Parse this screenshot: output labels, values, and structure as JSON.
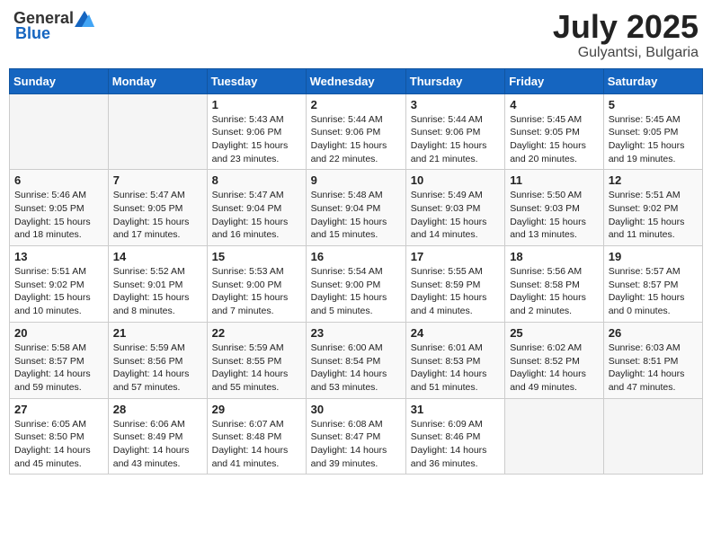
{
  "header": {
    "logo_general": "General",
    "logo_blue": "Blue",
    "month": "July 2025",
    "location": "Gulyantsi, Bulgaria"
  },
  "weekdays": [
    "Sunday",
    "Monday",
    "Tuesday",
    "Wednesday",
    "Thursday",
    "Friday",
    "Saturday"
  ],
  "weeks": [
    [
      {
        "day": "",
        "empty": true
      },
      {
        "day": "",
        "empty": true
      },
      {
        "day": "1",
        "sunrise": "Sunrise: 5:43 AM",
        "sunset": "Sunset: 9:06 PM",
        "daylight": "Daylight: 15 hours and 23 minutes."
      },
      {
        "day": "2",
        "sunrise": "Sunrise: 5:44 AM",
        "sunset": "Sunset: 9:06 PM",
        "daylight": "Daylight: 15 hours and 22 minutes."
      },
      {
        "day": "3",
        "sunrise": "Sunrise: 5:44 AM",
        "sunset": "Sunset: 9:06 PM",
        "daylight": "Daylight: 15 hours and 21 minutes."
      },
      {
        "day": "4",
        "sunrise": "Sunrise: 5:45 AM",
        "sunset": "Sunset: 9:05 PM",
        "daylight": "Daylight: 15 hours and 20 minutes."
      },
      {
        "day": "5",
        "sunrise": "Sunrise: 5:45 AM",
        "sunset": "Sunset: 9:05 PM",
        "daylight": "Daylight: 15 hours and 19 minutes."
      }
    ],
    [
      {
        "day": "6",
        "sunrise": "Sunrise: 5:46 AM",
        "sunset": "Sunset: 9:05 PM",
        "daylight": "Daylight: 15 hours and 18 minutes."
      },
      {
        "day": "7",
        "sunrise": "Sunrise: 5:47 AM",
        "sunset": "Sunset: 9:05 PM",
        "daylight": "Daylight: 15 hours and 17 minutes."
      },
      {
        "day": "8",
        "sunrise": "Sunrise: 5:47 AM",
        "sunset": "Sunset: 9:04 PM",
        "daylight": "Daylight: 15 hours and 16 minutes."
      },
      {
        "day": "9",
        "sunrise": "Sunrise: 5:48 AM",
        "sunset": "Sunset: 9:04 PM",
        "daylight": "Daylight: 15 hours and 15 minutes."
      },
      {
        "day": "10",
        "sunrise": "Sunrise: 5:49 AM",
        "sunset": "Sunset: 9:03 PM",
        "daylight": "Daylight: 15 hours and 14 minutes."
      },
      {
        "day": "11",
        "sunrise": "Sunrise: 5:50 AM",
        "sunset": "Sunset: 9:03 PM",
        "daylight": "Daylight: 15 hours and 13 minutes."
      },
      {
        "day": "12",
        "sunrise": "Sunrise: 5:51 AM",
        "sunset": "Sunset: 9:02 PM",
        "daylight": "Daylight: 15 hours and 11 minutes."
      }
    ],
    [
      {
        "day": "13",
        "sunrise": "Sunrise: 5:51 AM",
        "sunset": "Sunset: 9:02 PM",
        "daylight": "Daylight: 15 hours and 10 minutes."
      },
      {
        "day": "14",
        "sunrise": "Sunrise: 5:52 AM",
        "sunset": "Sunset: 9:01 PM",
        "daylight": "Daylight: 15 hours and 8 minutes."
      },
      {
        "day": "15",
        "sunrise": "Sunrise: 5:53 AM",
        "sunset": "Sunset: 9:00 PM",
        "daylight": "Daylight: 15 hours and 7 minutes."
      },
      {
        "day": "16",
        "sunrise": "Sunrise: 5:54 AM",
        "sunset": "Sunset: 9:00 PM",
        "daylight": "Daylight: 15 hours and 5 minutes."
      },
      {
        "day": "17",
        "sunrise": "Sunrise: 5:55 AM",
        "sunset": "Sunset: 8:59 PM",
        "daylight": "Daylight: 15 hours and 4 minutes."
      },
      {
        "day": "18",
        "sunrise": "Sunrise: 5:56 AM",
        "sunset": "Sunset: 8:58 PM",
        "daylight": "Daylight: 15 hours and 2 minutes."
      },
      {
        "day": "19",
        "sunrise": "Sunrise: 5:57 AM",
        "sunset": "Sunset: 8:57 PM",
        "daylight": "Daylight: 15 hours and 0 minutes."
      }
    ],
    [
      {
        "day": "20",
        "sunrise": "Sunrise: 5:58 AM",
        "sunset": "Sunset: 8:57 PM",
        "daylight": "Daylight: 14 hours and 59 minutes."
      },
      {
        "day": "21",
        "sunrise": "Sunrise: 5:59 AM",
        "sunset": "Sunset: 8:56 PM",
        "daylight": "Daylight: 14 hours and 57 minutes."
      },
      {
        "day": "22",
        "sunrise": "Sunrise: 5:59 AM",
        "sunset": "Sunset: 8:55 PM",
        "daylight": "Daylight: 14 hours and 55 minutes."
      },
      {
        "day": "23",
        "sunrise": "Sunrise: 6:00 AM",
        "sunset": "Sunset: 8:54 PM",
        "daylight": "Daylight: 14 hours and 53 minutes."
      },
      {
        "day": "24",
        "sunrise": "Sunrise: 6:01 AM",
        "sunset": "Sunset: 8:53 PM",
        "daylight": "Daylight: 14 hours and 51 minutes."
      },
      {
        "day": "25",
        "sunrise": "Sunrise: 6:02 AM",
        "sunset": "Sunset: 8:52 PM",
        "daylight": "Daylight: 14 hours and 49 minutes."
      },
      {
        "day": "26",
        "sunrise": "Sunrise: 6:03 AM",
        "sunset": "Sunset: 8:51 PM",
        "daylight": "Daylight: 14 hours and 47 minutes."
      }
    ],
    [
      {
        "day": "27",
        "sunrise": "Sunrise: 6:05 AM",
        "sunset": "Sunset: 8:50 PM",
        "daylight": "Daylight: 14 hours and 45 minutes."
      },
      {
        "day": "28",
        "sunrise": "Sunrise: 6:06 AM",
        "sunset": "Sunset: 8:49 PM",
        "daylight": "Daylight: 14 hours and 43 minutes."
      },
      {
        "day": "29",
        "sunrise": "Sunrise: 6:07 AM",
        "sunset": "Sunset: 8:48 PM",
        "daylight": "Daylight: 14 hours and 41 minutes."
      },
      {
        "day": "30",
        "sunrise": "Sunrise: 6:08 AM",
        "sunset": "Sunset: 8:47 PM",
        "daylight": "Daylight: 14 hours and 39 minutes."
      },
      {
        "day": "31",
        "sunrise": "Sunrise: 6:09 AM",
        "sunset": "Sunset: 8:46 PM",
        "daylight": "Daylight: 14 hours and 36 minutes."
      },
      {
        "day": "",
        "empty": true
      },
      {
        "day": "",
        "empty": true
      }
    ]
  ]
}
